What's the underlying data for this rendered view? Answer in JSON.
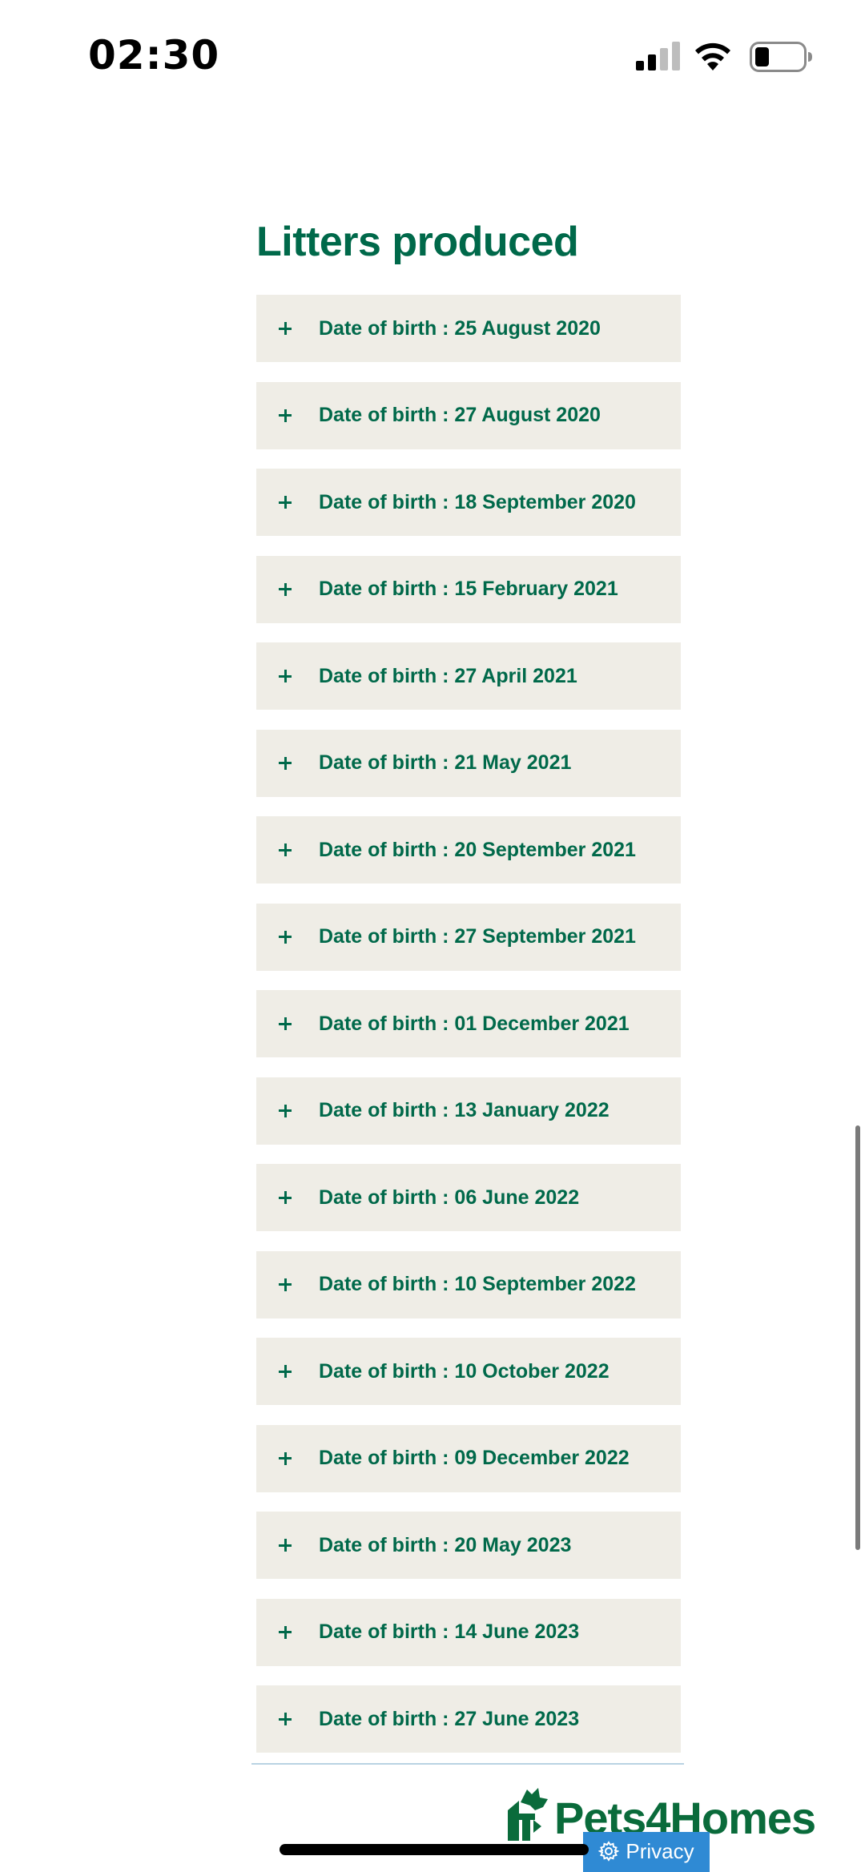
{
  "status_bar": {
    "time": "02:30"
  },
  "section": {
    "title": "Litters produced"
  },
  "litters": [
    {
      "label": "Date of birth : 25 August 2020"
    },
    {
      "label": "Date of birth : 27 August 2020"
    },
    {
      "label": "Date of birth : 18 September 2020"
    },
    {
      "label": "Date of birth : 15 February 2021"
    },
    {
      "label": "Date of birth : 27 April 2021"
    },
    {
      "label": "Date of birth : 21 May 2021"
    },
    {
      "label": "Date of birth : 20 September 2021"
    },
    {
      "label": "Date of birth : 27 September 2021"
    },
    {
      "label": "Date of birth : 01 December 2021"
    },
    {
      "label": "Date of birth : 13 January 2022"
    },
    {
      "label": "Date of birth : 06 June 2022"
    },
    {
      "label": "Date of birth : 10 September 2022"
    },
    {
      "label": "Date of birth : 10 October 2022"
    },
    {
      "label": "Date of birth : 09 December 2022"
    },
    {
      "label": "Date of birth : 20 May 2023"
    },
    {
      "label": "Date of birth : 14 June 2023"
    },
    {
      "label": "Date of birth : 27 June 2023"
    }
  ],
  "footer": {
    "logo_text": "Pets4Homes",
    "privacy_label": "Privacy"
  },
  "icons": {
    "item_expand": "plus-icon",
    "privacy": "gear-icon",
    "logo": "pets4homes-logo-icon"
  },
  "colors": {
    "brand_green": "#00694a",
    "item_background": "#efede6",
    "privacy_blue": "#2f8ad4"
  }
}
